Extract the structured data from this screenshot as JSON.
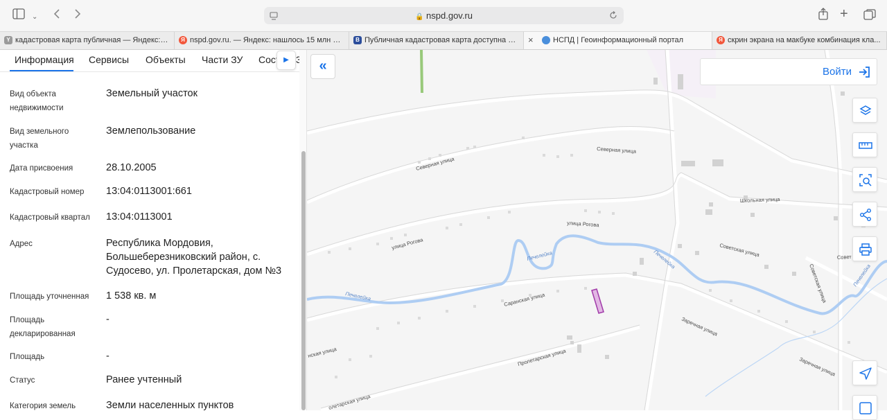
{
  "browser": {
    "url": "nspd.gov.ru",
    "tabs": [
      {
        "label": "кадастровая карта публичная — Яндекс: н...",
        "favicon": "Y",
        "favicon_color": "#9a9a9a"
      },
      {
        "label": "nspd.gov.ru. — Яндекс: нашлось 15 млн ре...",
        "favicon": "Я",
        "favicon_color": "#f2573c"
      },
      {
        "label": "Публичная кадастровая карта доступна н...",
        "favicon": "B",
        "favicon_color": "#2b4d9b"
      },
      {
        "label": "НСПД | Геоинформационный портал",
        "favicon": "",
        "favicon_color": "#4a8fdc"
      },
      {
        "label": "скрин экрана на макбуке комбинация кла...",
        "favicon": "Я",
        "favicon_color": "#f2573c"
      }
    ],
    "tab_close": "×"
  },
  "panel": {
    "tabs": [
      "Информация",
      "Сервисы",
      "Объекты",
      "Части ЗУ",
      "Сост",
      "3"
    ],
    "fields": [
      {
        "label": "Вид объекта недвижимости",
        "value": "Земельный участок"
      },
      {
        "label": "Вид земельного участка",
        "value": "Землепользование"
      },
      {
        "label": "Дата присвоения",
        "value": "28.10.2005"
      },
      {
        "label": "Кадастровый номер",
        "value": "13:04:0113001:661"
      },
      {
        "label": "Кадастровый квартал",
        "value": "13:04:0113001"
      },
      {
        "label": "Адрес",
        "value": "Республика Мордовия, Большеберезниковский район, с. Судосево, ул. Пролетарская, дом №3"
      },
      {
        "label": "Площадь уточненная",
        "value": "1 538 кв. м"
      },
      {
        "label": "Площадь декларированная",
        "value": "-"
      },
      {
        "label": "Площадь",
        "value": "-"
      },
      {
        "label": "Статус",
        "value": "Ранее учтенный"
      },
      {
        "label": "Категория земель",
        "value": "Земли населенных пунктов"
      }
    ]
  },
  "map": {
    "login_label": "Войти",
    "streets": {
      "severnaya": "Северная улица",
      "severnaya2": "Северная улица",
      "shkolnaya": "Школьная улица",
      "rogova": "улица Рогова",
      "rogova2": "улица Рогова",
      "sovetskaya": "Советская улица",
      "sovetskaya2": "Советская улица",
      "sovetskaya3": "Совет",
      "saranskaya": "Саранская улица",
      "saranskaya2": "нская улица",
      "zarechnaya": "Заречная улица",
      "zarechnaya2": "Заречная улица",
      "proletarskaya": "Пролетарская улица",
      "proletarskaya2": "олетарская улица",
      "pechelejka1": "Печелейка",
      "pechelejka2": "Печелейка",
      "pechelejka3": "Печелейка",
      "pechelejka4": "Печелейка"
    },
    "colors": {
      "accent": "#1a73e8",
      "river": "#aecdf3",
      "parcel_fill": "#e2b7e4",
      "parcel_stroke": "#a03aa8"
    }
  }
}
